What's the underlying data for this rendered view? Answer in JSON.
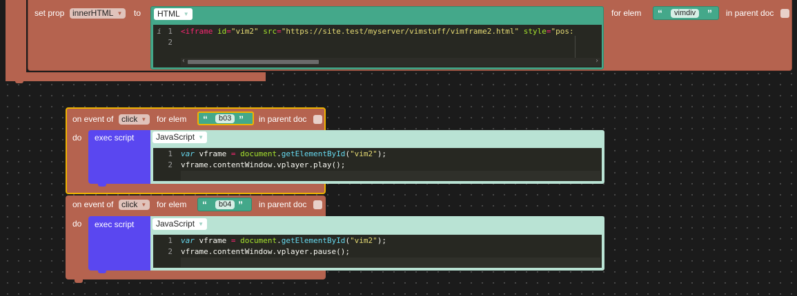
{
  "top_block": {
    "set_prop_label": "set prop",
    "prop_value": "innerHTML",
    "to_label": "to",
    "lang_value": "HTML",
    "for_elem_label": "for elem",
    "elem_id": "vimdiv",
    "in_parent_doc_label": "in parent doc",
    "editor": {
      "gutter_info": "i",
      "line_numbers": [
        "1",
        "2"
      ],
      "line1_lt": "<",
      "line1_tag": "iframe",
      "line1_attr1": "id",
      "line1_eq1": "=",
      "line1_val1": "\"vim2\"",
      "line1_attr2": "src",
      "line1_eq2": "=",
      "line1_val2": "\"https://site.test/myserver/vimstuff/vimframe2.html\"",
      "line1_attr3": "style",
      "line1_eq3": "=",
      "line1_val3": "\"pos:",
      "scroll_left": "‹",
      "scroll_right": "›"
    }
  },
  "event_blocks": [
    {
      "on_event_label": "on event of",
      "event_value": "click",
      "for_elem_label": "for elem",
      "elem_id": "b03",
      "in_parent_doc_label": "in parent doc",
      "do_label": "do",
      "exec_label": "exec script",
      "lang_value": "JavaScript",
      "line_numbers": [
        "1",
        "2"
      ],
      "code": {
        "var_kw": "var",
        "var_name": " vframe ",
        "eq": "=",
        "sp": " ",
        "doc_obj": "document",
        "dot": ".",
        "method": "getElementById",
        "open": "(",
        "arg": "\"vim2\"",
        "close": ");",
        "line2": "vframe.contentWindow.vplayer.play();"
      }
    },
    {
      "on_event_label": "on event of",
      "event_value": "click",
      "for_elem_label": "for elem",
      "elem_id": "b04",
      "in_parent_doc_label": "in parent doc",
      "do_label": "do",
      "exec_label": "exec script",
      "lang_value": "JavaScript",
      "line_numbers": [
        "1",
        "2"
      ],
      "code": {
        "var_kw": "var",
        "var_name": " vframe ",
        "eq": "=",
        "sp": " ",
        "doc_obj": "document",
        "dot": ".",
        "method": "getElementById",
        "open": "(",
        "arg": "\"vim2\"",
        "close": ");",
        "line2": "vframe.contentWindow.vplayer.pause();"
      }
    }
  ],
  "dropdown_arrow": "▼",
  "open_quote": "“",
  "close_quote": "”",
  "colors": {
    "workspace": "#1b1b1b",
    "event_block": "#b5634f",
    "string_block": "#44a88a",
    "exec_block": "#5a47f0",
    "code_panel": "#b9e3d4",
    "selection_outline": "#f0b400",
    "editor_bg": "#272822"
  }
}
